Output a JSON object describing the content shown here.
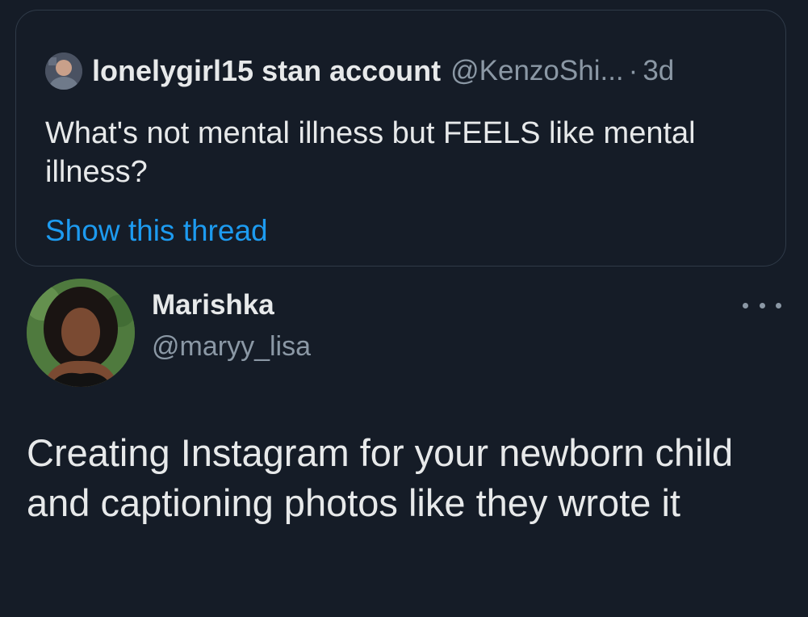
{
  "quoted_tweet": {
    "display_name": "lonelygirl15 stan account",
    "handle": "@KenzoShi...",
    "separator": "·",
    "timestamp": "3d",
    "text": "What's not mental illness but FEELS like mental illness?",
    "show_thread_label": "Show this thread"
  },
  "tweet": {
    "display_name": "Marishka",
    "handle": "@maryy_lisa",
    "text": "Creating Instagram for your newborn child and captioning photos like they wrote it",
    "more_icon": "more-horizontal-icon"
  },
  "colors": {
    "background": "#151c27",
    "text_primary": "#e7e9ea",
    "text_secondary": "#8b98a5",
    "link": "#1d9bf0",
    "border": "#2f3a48"
  }
}
